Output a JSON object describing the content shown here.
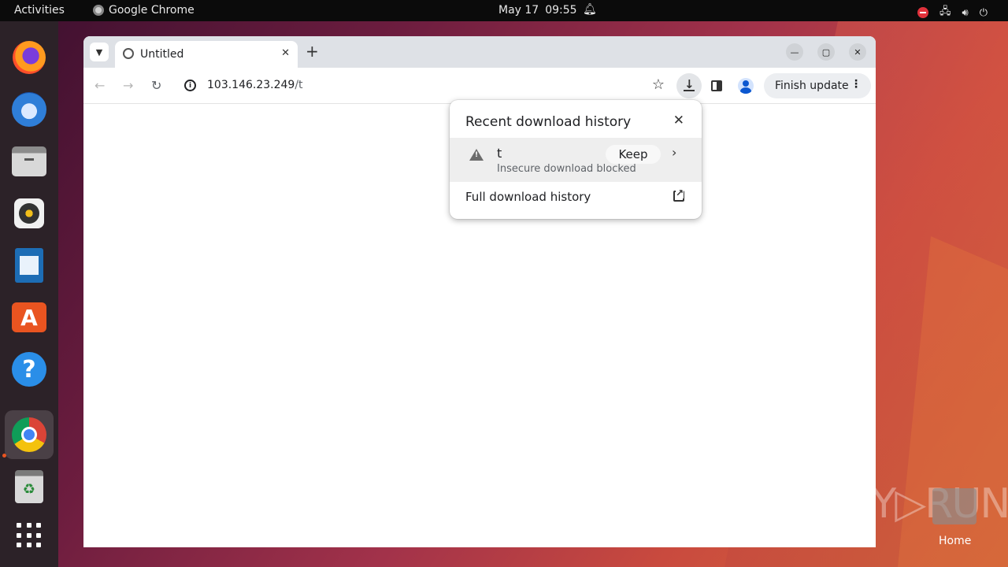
{
  "topbar": {
    "activities": "Activities",
    "app_name": "Google Chrome",
    "date": "May 17",
    "time": "09:55"
  },
  "browser": {
    "tab_title": "Untitled",
    "url_host": "103.146.23.249",
    "url_path": "/t",
    "update_button": "Finish update"
  },
  "download_bubble": {
    "title": "Recent download history",
    "item": {
      "filename": "t",
      "status": "Insecure download blocked",
      "keep_label": "Keep"
    },
    "full_history": "Full download history"
  },
  "desktop": {
    "watermark": "ANY▷RUN",
    "home_label": "Home"
  },
  "colors": {
    "accent": "#e95420",
    "chrome_tabstrip": "#dee1e6"
  }
}
